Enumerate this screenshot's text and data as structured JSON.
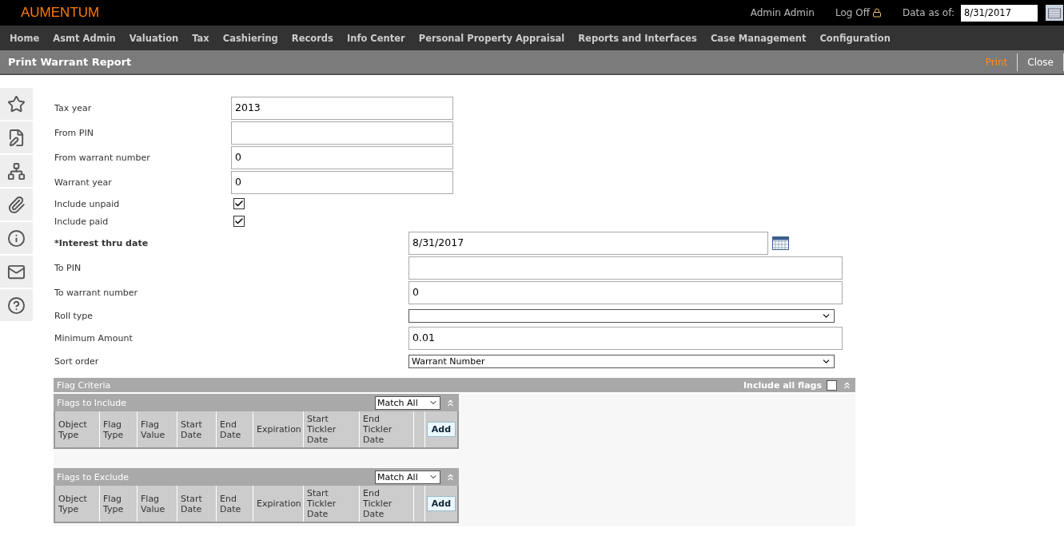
{
  "header": {
    "logo": "AUMENTUM",
    "user": "Admin Admin",
    "logoff": "Log Off",
    "data_as_of_label": "Data as of:",
    "data_as_of_value": "8/31/2017"
  },
  "nav": [
    "Home",
    "Asmt Admin",
    "Valuation",
    "Tax",
    "Cashiering",
    "Records",
    "Info Center",
    "Personal Property Appraisal",
    "Reports and Interfaces",
    "Case Management",
    "Configuration"
  ],
  "page_title": "Print Warrant Report",
  "actions": [
    {
      "label": "Print",
      "kind": "primary"
    },
    {
      "label": "Close",
      "kind": "normal"
    }
  ],
  "upper_fields": [
    {
      "kind": "text",
      "label": "Tax year",
      "value": "2013"
    },
    {
      "kind": "text",
      "label": "From PIN"
    },
    {
      "kind": "text",
      "label": "From warrant number",
      "value": "0"
    },
    {
      "kind": "text",
      "label": "Warrant year",
      "value": "0"
    },
    {
      "kind": "checkbox",
      "label": "Include unpaid",
      "checked": true
    },
    {
      "kind": "checkbox",
      "label": "Include paid",
      "checked": true
    }
  ],
  "lower_fields": [
    {
      "kind": "date",
      "label": "*Interest thru date",
      "required": true,
      "value": "8/31/2017"
    },
    {
      "kind": "text",
      "label": "To PIN",
      "required": false
    },
    {
      "kind": "text",
      "label": "To warrant number",
      "required": false,
      "value": "0"
    },
    {
      "kind": "select",
      "label": "Roll type",
      "required": false
    },
    {
      "kind": "text",
      "label": "Minimum Amount",
      "required": false,
      "value": "0.01"
    },
    {
      "kind": "select",
      "label": "Sort order",
      "required": false,
      "value": "Warrant Number"
    }
  ],
  "flag_criteria": {
    "title": "Flag Criteria",
    "include_all_label": "Include all flags",
    "include_all_checked": false,
    "tables": [
      {
        "title": "Flags to Include",
        "match": "Match All",
        "columns": [
          "Object Type",
          "Flag Type",
          "Flag Value",
          "Start Date",
          "End Date",
          "Expiration",
          "Start Tickler Date",
          "End Tickler Date"
        ],
        "add": "Add"
      },
      {
        "title": "Flags to Exclude",
        "match": "Match All",
        "columns": [
          "Object Type",
          "Flag Type",
          "Flag Value",
          "Start Date",
          "End Date",
          "Expiration",
          "Start Tickler Date",
          "End Tickler Date"
        ],
        "add": "Add"
      }
    ]
  }
}
